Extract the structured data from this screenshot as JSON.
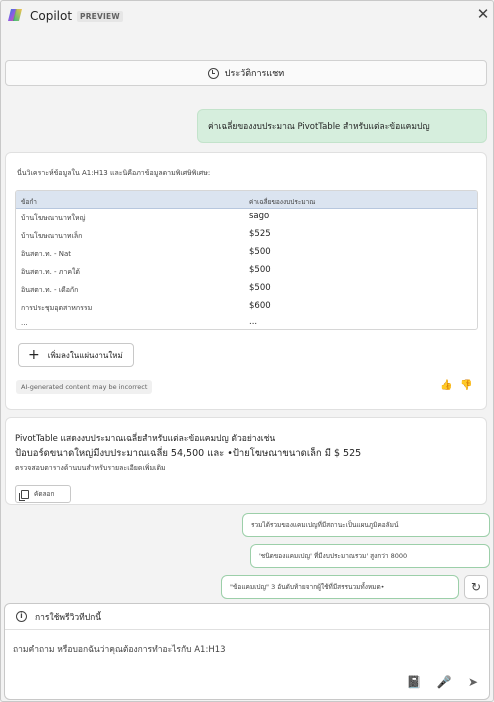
{
  "header": {
    "title": "Copilot",
    "badge": "PREVIEW",
    "close_glyph": "✕"
  },
  "history_button": {
    "label": "ประวัติการแชท"
  },
  "user_message": "ค่าเฉลี่ยของงบประมาณ PivotTable สำหรับแต่ละข้อแคมปญ",
  "response_card": {
    "intro": "นี่นวิเคราะห์ข้อมูลใน A1:H13 และนิคือภาข้อมูลดามพิเศษิพิเศษ:",
    "table": {
      "headers": [
        "ข้อกำ",
        "ค่าเฉลี่ยของงบประมาณ"
      ],
      "rows": [
        [
          "บ้านโฆษณานาทใหญ่",
          "sago"
        ],
        [
          "บ้านโฆษณานาทเล็ก",
          "$525"
        ],
        [
          "อินสตา.ท. - Nat",
          "$500"
        ],
        [
          "อินสตา.ท. - ภาคใต้",
          "$500"
        ],
        [
          "อินสตา.ท. - เดือกัก",
          "$500"
        ],
        [
          "การประชุมอุตสาหกรรม",
          "$600"
        ],
        [
          "...",
          "..."
        ]
      ]
    },
    "add_button": "เพิ่มลงในแผ่นงานใหม่",
    "ai_disclaimer": "AI-generated content may be incorrect",
    "thumbs_up": "👍",
    "thumbs_down": "👎"
  },
  "summary_card": {
    "line1": "PivotTable แสดงงบประมาณเฉลี่ยสำหรับแต่ละข้อแคมปญ ตัวอย่างเช่น",
    "line2": "ป้อบอร์ดขนาดใหญ่มีงบประมาณเฉลี่ย 54,500 และ •ป้ายโฆษณาขนาดเล็ก มี $ 525",
    "line3": "ตรวจสอบตารางด้านบนสำหรับรายละเอียดเพิ่มเติม",
    "copy_label": "คัดลอก"
  },
  "suggestions": [
    "รวมได้รวมของแคมเปญที่มีสถานะเป็นแผนภูมิคอลัมน์",
    "'ชนิดของแคมเปญ' ที่มีงบประมาณรวม' สูงกว่า 8000",
    "\"ข้อแคมเปญ\" 3 อันดับท้ายจากผู้ใช้ที่มีสรรนวมทั้งหมด•"
  ],
  "refresh_glyph": "↻",
  "compose": {
    "prompt_guide_label": "การใช้พรีวิวทีปกนี้",
    "input_placeholder": "ถามคำถาม หรือบอกฉันว่าคุณต้องการทำอะไรกับ A1:H13",
    "tool_icons": [
      "📓",
      "🎤",
      "➤"
    ]
  },
  "colors": {
    "user_bubble": "#d6eedd",
    "table_header": "#dbe4f0",
    "suggestion_border": "#9ccfa9"
  }
}
